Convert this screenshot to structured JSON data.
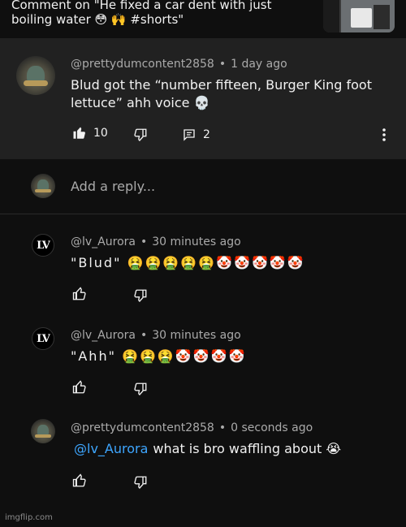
{
  "context": {
    "text": "Comment on \"He fixed a car dent with just boiling water 😳 🙌 #shorts\""
  },
  "parent_comment": {
    "author": "@prettydumcontent2858",
    "time": "1 day ago",
    "text": "Blud got the “number fifteen, Burger King foot lettuce” ahh voice 💀",
    "like_count": "10",
    "reply_count": "2"
  },
  "add_reply": {
    "placeholder": "Add a reply..."
  },
  "replies": [
    {
      "author": "@lv_Aurora",
      "avatar_text": "LV",
      "time": "30 minutes ago",
      "text": "\"Blud\" 🤮🤮🤮🤮🤮🤡🤡🤡🤡🤡"
    },
    {
      "author": "@lv_Aurora",
      "avatar_text": "LV",
      "time": "30 minutes ago",
      "text": "\"Ahh\" 🤮🤮🤮🤡🤡🤡🤡"
    },
    {
      "author": "@prettydumcontent2858",
      "time": "0 seconds ago",
      "mention": "@lv_Aurora",
      "text": "what is bro waffling about 😭"
    }
  ],
  "watermark": "imgflip.com",
  "colors": {
    "background": "#0f0f0f",
    "highlight": "#212121",
    "mention": "#3ea6ff",
    "meta": "#aaaaaa"
  }
}
